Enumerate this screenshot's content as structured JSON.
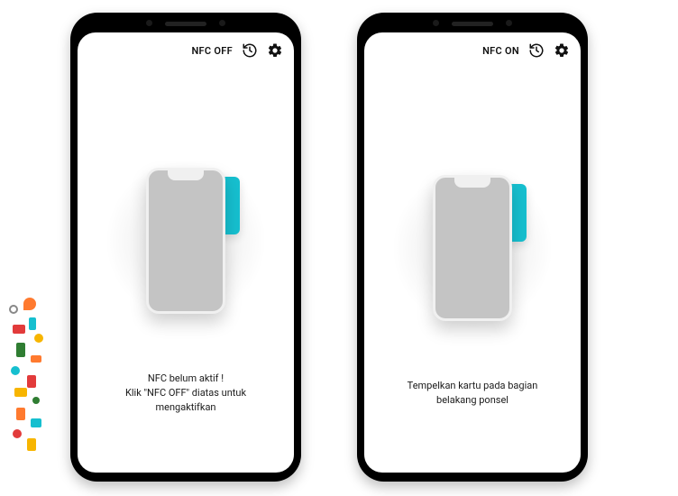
{
  "colors": {
    "accent": "#16bfcf"
  },
  "phones": [
    {
      "nfc_label": "NFC OFF",
      "caption_line1": "NFC belum aktif !",
      "caption_line2": "Klik \"NFC OFF\" diatas untuk mengaktifkan"
    },
    {
      "nfc_label": "NFC ON",
      "caption_line1": "Tempelkan kartu pada bagian",
      "caption_line2": "belakang ponsel"
    }
  ]
}
